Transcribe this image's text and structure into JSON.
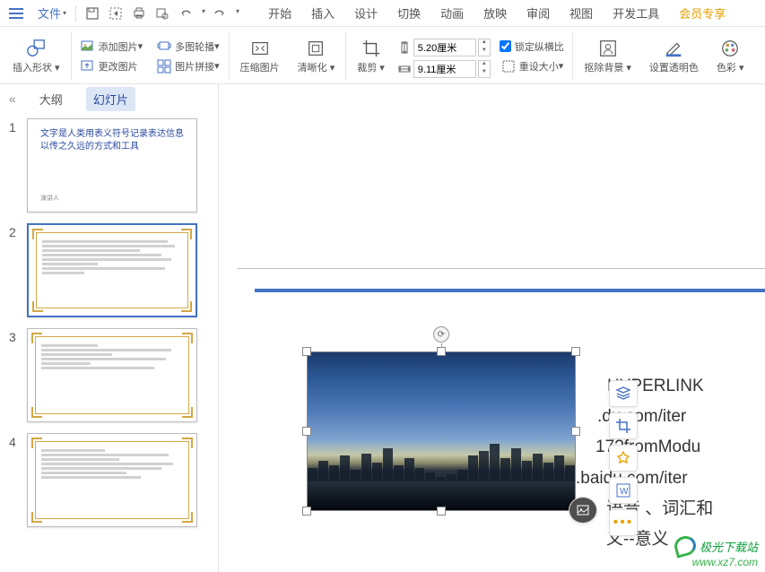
{
  "menubar": {
    "file": "文件"
  },
  "tabs": {
    "start": "开始",
    "insert": "插入",
    "design": "设计",
    "transition": "切换",
    "animation": "动画",
    "slideshow": "放映",
    "review": "审阅",
    "view": "视图",
    "devtools": "开发工具",
    "vip": "会员专享"
  },
  "ribbon": {
    "insert_shape": "插入形状",
    "add_picture": "添加图片",
    "change_picture": "更改图片",
    "multi_carousel": "多图轮播",
    "picture_link": "图片拼接",
    "compress": "压缩图片",
    "sharpen": "清晰化",
    "crop": "裁剪",
    "height_val": "5.20厘米",
    "width_val": "9.11厘米",
    "lock_ratio": "锁定纵横比",
    "reset_size": "重设大小",
    "remove_bg": "抠除背景",
    "set_transparent": "设置透明色",
    "color": "色彩"
  },
  "sidepanel": {
    "outline": "大纲",
    "slides": "幻灯片",
    "thumb1_title": "文字是人类用表义符号记录表达信息以传之久远的方式和工具",
    "thumb1_presenter": "演讲人"
  },
  "canvas": {
    "behind1": "HYPERLINK",
    "behind2": ".du.com/iter",
    "behind3": "17?fromModu",
    "behind4": ".baidu.com/iter",
    "behind5": "语音 、词汇和",
    "behind6": "义--意义"
  },
  "watermark": {
    "name": "极光下载站",
    "url": "www.xz7.com"
  }
}
